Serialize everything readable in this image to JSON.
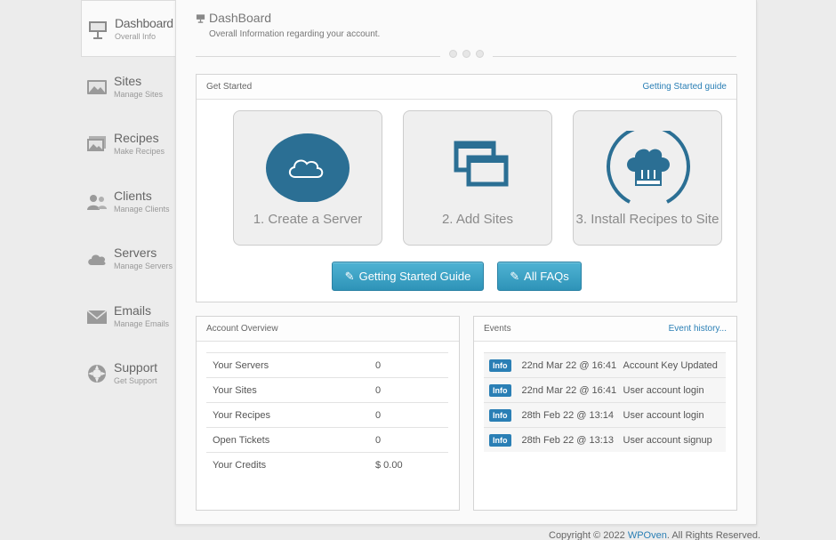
{
  "sidebar": {
    "items": [
      {
        "title": "Dashboard",
        "sub": "Overall Info",
        "icon": "presentation-icon"
      },
      {
        "title": "Sites",
        "sub": "Manage Sites",
        "icon": "image-icon"
      },
      {
        "title": "Recipes",
        "sub": "Make Recipes",
        "icon": "pictures-icon"
      },
      {
        "title": "Clients",
        "sub": "Manage Clients",
        "icon": "users-icon"
      },
      {
        "title": "Servers",
        "sub": "Manage Servers",
        "icon": "cloud-icon"
      },
      {
        "title": "Emails",
        "sub": "Manage Emails",
        "icon": "envelope-icon"
      },
      {
        "title": "Support",
        "sub": "Get Support",
        "icon": "lifebuoy-icon"
      }
    ]
  },
  "header": {
    "title": "DashBoard",
    "subtitle": "Overall Information regarding your account."
  },
  "get_started": {
    "heading": "Get Started",
    "guide_link": "Getting Started guide",
    "cards": [
      {
        "label": "1. Create a Server",
        "icon": "cloud-icon"
      },
      {
        "label": "2. Add Sites",
        "icon": "windows-icon"
      },
      {
        "label": "3. Install Recipes to Site",
        "icon": "chef-hat-icon"
      }
    ],
    "buttons": {
      "guide": "Getting Started Guide",
      "faqs": "All FAQs"
    }
  },
  "account": {
    "heading": "Account Overview",
    "rows": [
      {
        "label": "Your Servers",
        "value": "0"
      },
      {
        "label": "Your Sites",
        "value": "0"
      },
      {
        "label": "Your Recipes",
        "value": "0"
      },
      {
        "label": "Open Tickets",
        "value": "0"
      },
      {
        "label": "Your Credits",
        "value": "$ 0.00"
      }
    ]
  },
  "events": {
    "heading": "Events",
    "history_link": "Event history...",
    "rows": [
      {
        "badge": "Info",
        "date": "22nd Mar 22 @ 16:41",
        "text": "Account Key Updated"
      },
      {
        "badge": "Info",
        "date": "22nd Mar 22 @ 16:41",
        "text": "User account login"
      },
      {
        "badge": "Info",
        "date": "28th Feb 22 @ 13:14",
        "text": "User account login"
      },
      {
        "badge": "Info",
        "date": "28th Feb 22 @ 13:13",
        "text": "User account signup"
      }
    ]
  },
  "footer": {
    "prefix": "Copyright © 2022 ",
    "brand": "WPOven",
    "suffix": ". All Rights Reserved."
  },
  "colors": {
    "accent": "#2a7fb5",
    "icon_teal": "#2b6f94",
    "button": "#3aa3c8"
  }
}
